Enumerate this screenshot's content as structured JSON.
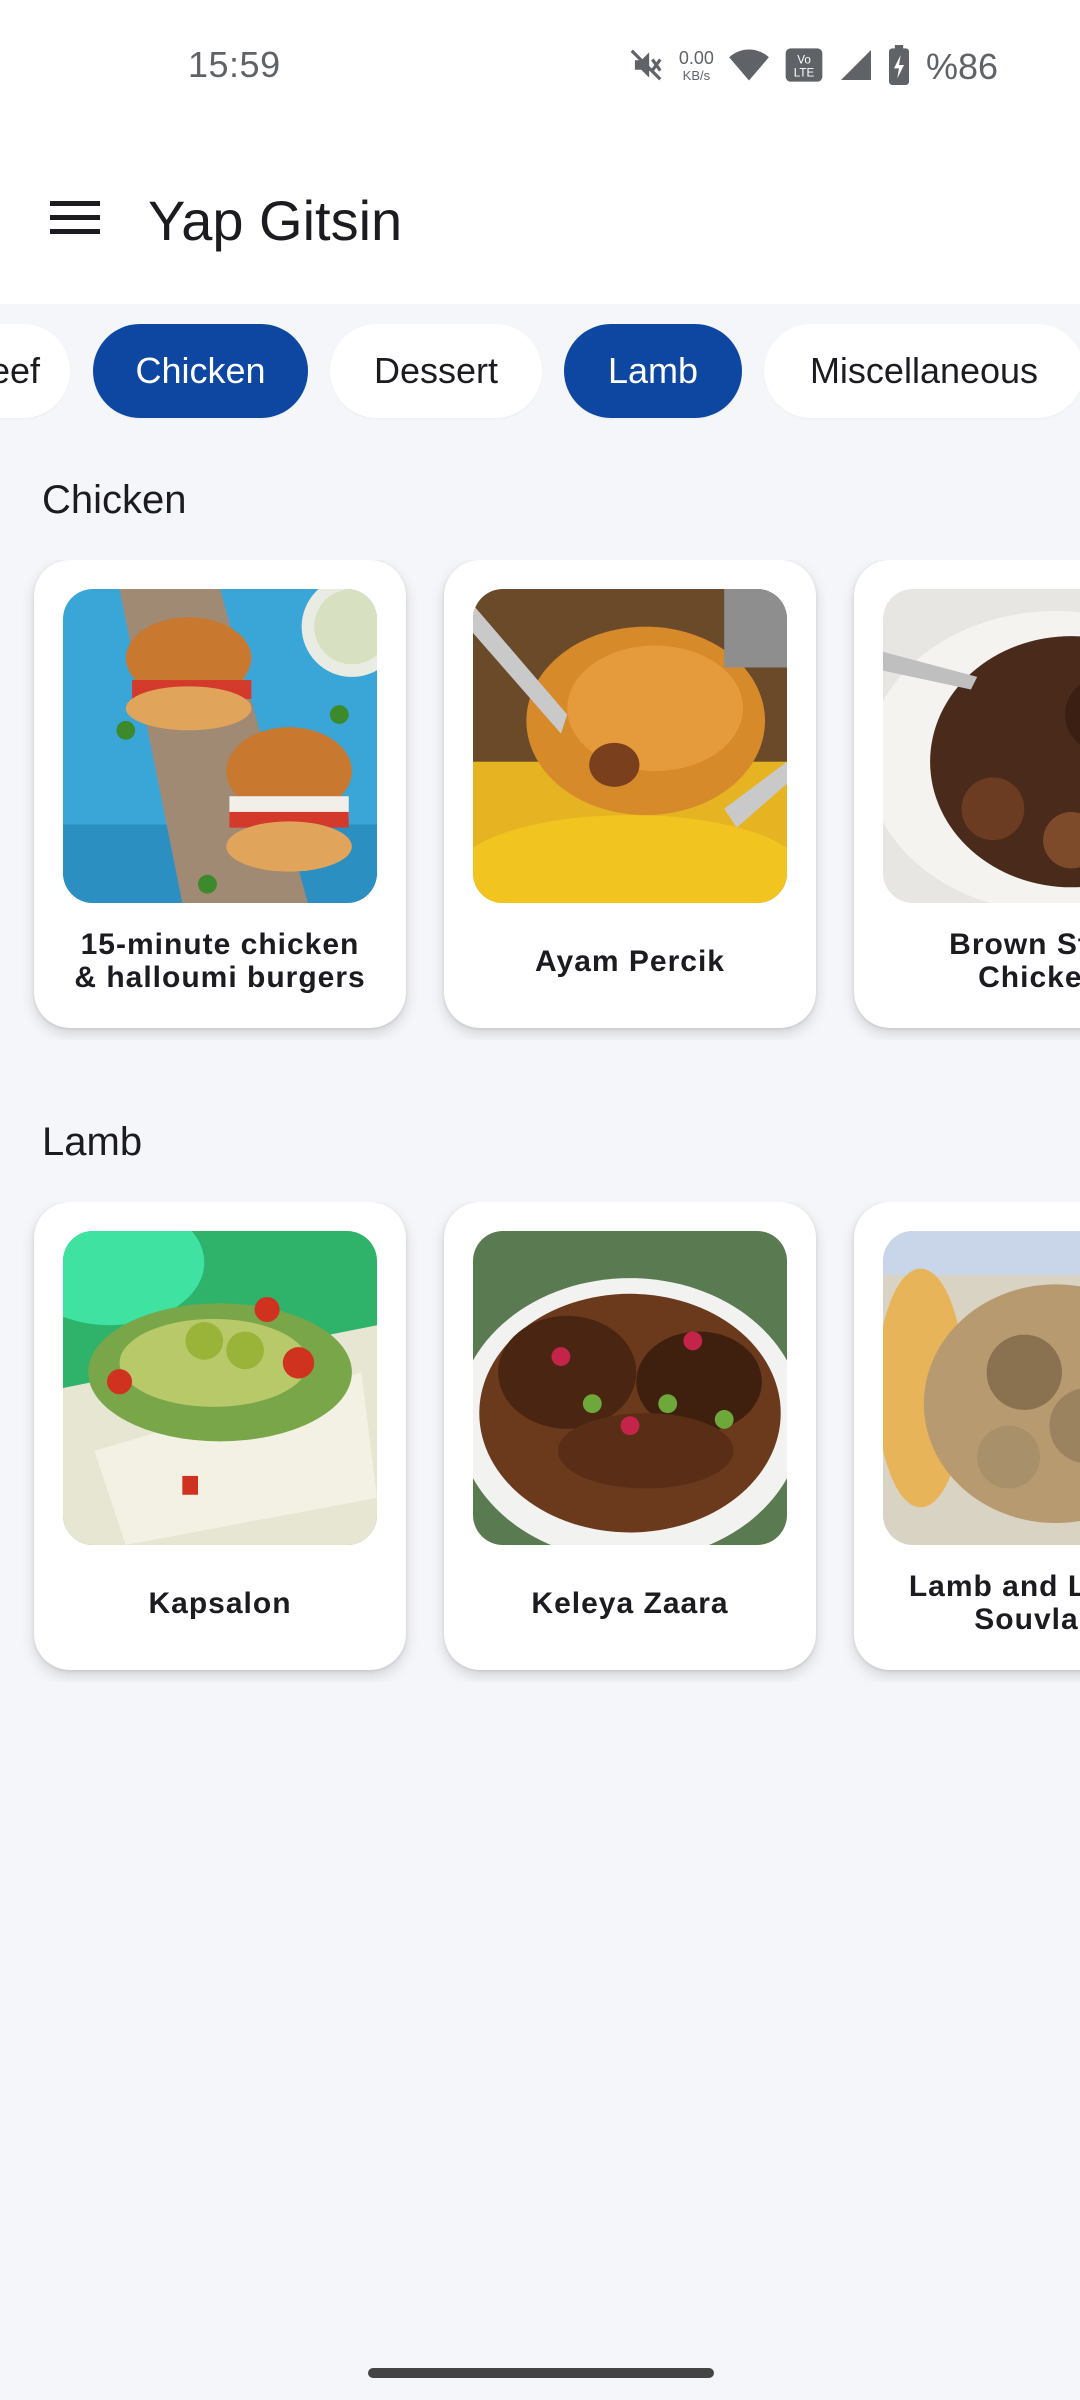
{
  "status_bar": {
    "time": "15:59",
    "net_speed_value": "0.00",
    "net_speed_unit": "KB/s",
    "volte_label": "Vo\nLTE",
    "battery_text": "%86",
    "icons": [
      "mute-icon",
      "wifi-icon",
      "volte-icon",
      "signal-icon",
      "battery-charging-icon"
    ]
  },
  "app_bar": {
    "title": "Yap Gitsin",
    "menu_icon": "hamburger-menu-icon"
  },
  "categories": [
    {
      "label": "Beef",
      "selected": false
    },
    {
      "label": "Chicken",
      "selected": true
    },
    {
      "label": "Dessert",
      "selected": false
    },
    {
      "label": "Lamb",
      "selected": true
    },
    {
      "label": "Miscellaneous",
      "selected": false
    }
  ],
  "sections": [
    {
      "title": "Chicken",
      "items": [
        {
          "name": "15-minute chicken\n& halloumi burgers"
        },
        {
          "name": "Ayam Percik"
        },
        {
          "name": "Brown Stew\nChicken"
        }
      ]
    },
    {
      "title": "Lamb",
      "items": [
        {
          "name": "Kapsalon"
        },
        {
          "name": "Keleya Zaara"
        },
        {
          "name": "Lamb and Lemon\nSouvlaki"
        }
      ]
    }
  ],
  "colors": {
    "accent": "#0d47a1",
    "background": "#f5f6fa",
    "surface": "#ffffff"
  }
}
